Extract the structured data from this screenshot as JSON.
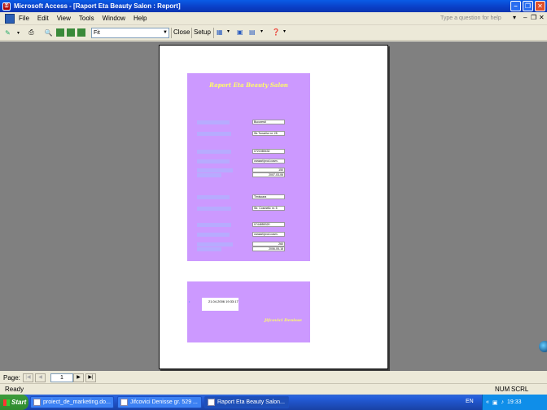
{
  "window": {
    "title": "Microsoft Access - [Raport Eta Beauty Salon : Report]",
    "icon": "access-key-icon"
  },
  "menu": {
    "items": [
      "File",
      "Edit",
      "View",
      "Tools",
      "Window",
      "Help"
    ],
    "help_placeholder": "Type a question for help"
  },
  "toolbar": {
    "zoom_value": "Fit",
    "close_label": "Close",
    "setup_label": "Setup"
  },
  "report": {
    "title": "Raport Eta Beauty Salon",
    "record1": {
      "values": [
        "Bucuresti",
        "Str.Tunarilor nr. 25",
        "0721989432",
        "vanzari/prod.cosm.",
        "150",
        "2007-03-06"
      ]
    },
    "record2": {
      "values": [
        "Timisoara",
        "Str. Cosmetic nr. 5",
        "0744855320",
        "vanzari/prod.cosm.",
        "260",
        "2006-05-18"
      ]
    },
    "footer": {
      "timestamp": "21.04.2006 19:33:17",
      "author": "Jifcovici Denisse"
    }
  },
  "navigation": {
    "label": "Page:",
    "page_value": "1"
  },
  "status": {
    "text": "Ready",
    "indicators": [
      "NUM",
      "SCRL"
    ]
  },
  "taskbar": {
    "start_label": "Start",
    "tasks": [
      "proiect_de_marketing.do...",
      "Jifcovici Denisse gr. 529 ...",
      "Raport Eta Beauty Salon..."
    ],
    "language": "EN",
    "clock": "19:33"
  }
}
